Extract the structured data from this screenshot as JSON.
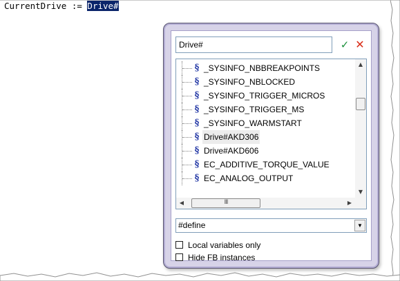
{
  "editor": {
    "code_prefix": "CurrentDrive := ",
    "selected_text": "Drive#"
  },
  "popup": {
    "search": {
      "value": "Drive#",
      "ok_icon": "checkmark-icon",
      "cancel_icon": "close-icon"
    },
    "tree": {
      "items": [
        {
          "label": "_SYSINFO_NBBREAKPOINTS",
          "icon": "define-symbol-icon",
          "selected": false
        },
        {
          "label": "_SYSINFO_NBLOCKED",
          "icon": "define-symbol-icon",
          "selected": false
        },
        {
          "label": "_SYSINFO_TRIGGER_MICROS",
          "icon": "define-symbol-icon",
          "selected": false
        },
        {
          "label": "_SYSINFO_TRIGGER_MS",
          "icon": "define-symbol-icon",
          "selected": false
        },
        {
          "label": "_SYSINFO_WARMSTART",
          "icon": "define-symbol-icon",
          "selected": false
        },
        {
          "label": "Drive#AKD306",
          "icon": "define-symbol-icon",
          "selected": true
        },
        {
          "label": "Drive#AKD606",
          "icon": "define-symbol-icon",
          "selected": false
        },
        {
          "label": "EC_ADDITIVE_TORQUE_VALUE",
          "icon": "define-symbol-icon",
          "selected": false
        },
        {
          "label": "EC_ANALOG_OUTPUT",
          "icon": "define-symbol-icon",
          "selected": false
        }
      ],
      "hscroll_grip": "III"
    },
    "filter": {
      "selected": "#define"
    },
    "options": {
      "local_only": {
        "label": "Local variables only",
        "checked": false
      },
      "hide_fb": {
        "label": "Hide FB instances",
        "checked": false
      }
    }
  },
  "colors": {
    "selection_bg": "#0a246a",
    "popup_border": "#a59fc8",
    "symbol_icon": "#2a3ea8",
    "ok_green": "#1a8f3a",
    "cancel_red": "#d92b16"
  }
}
